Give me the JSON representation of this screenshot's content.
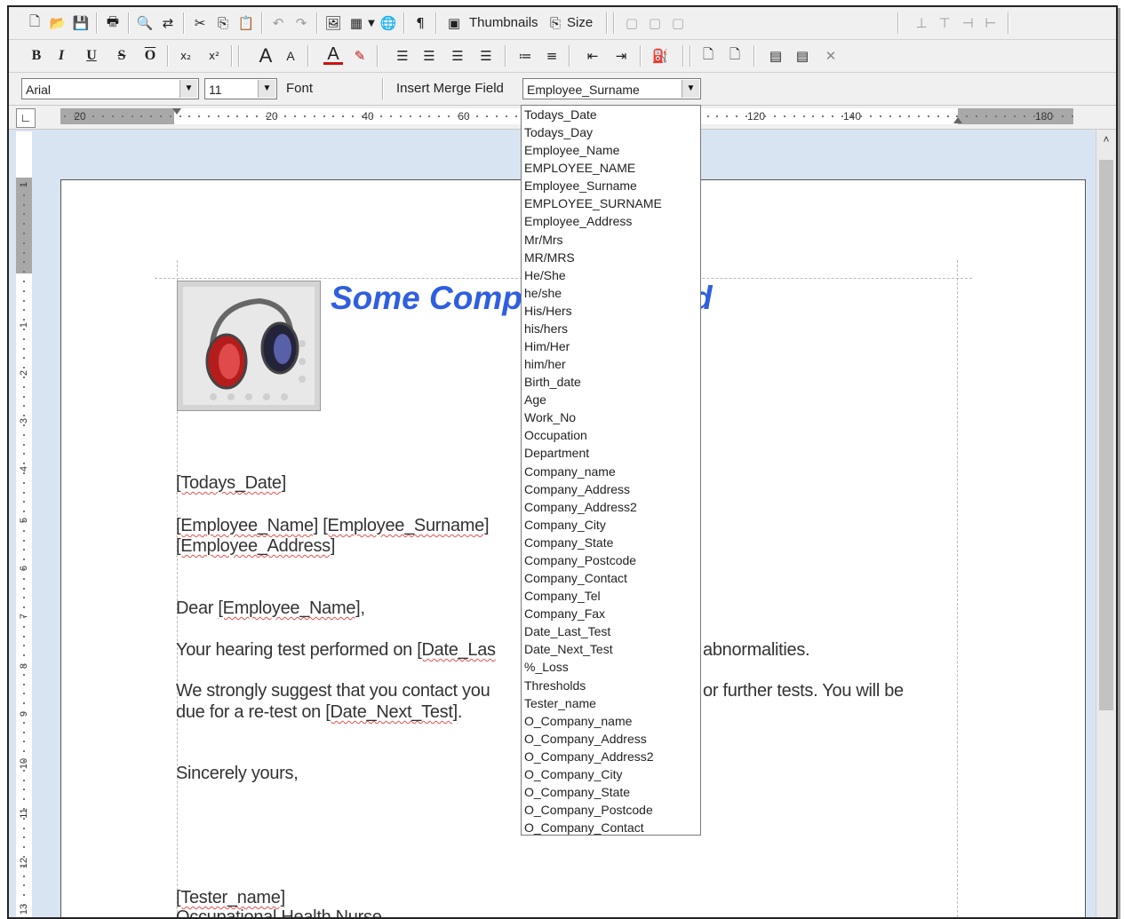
{
  "toolbar1": {
    "thumbnails_label": "Thumbnails",
    "size_label": "Size"
  },
  "toolbar2": {
    "bold_label": "B",
    "italic_label": "I",
    "underline_label": "U",
    "strike_label": "S",
    "overline_label": "O"
  },
  "toolbar3": {
    "font_name": "Arial",
    "font_size": "11",
    "font_label": "Font",
    "insert_merge_label": "Insert Merge Field",
    "merge_field_selected": "Employee_Surname"
  },
  "ruler": {
    "h_labels": [
      "20",
      "20",
      "40",
      "60",
      "120",
      "140",
      "180"
    ],
    "v_labels": [
      "1",
      "1",
      "2",
      "3",
      "4",
      "5",
      "6",
      "7",
      "8",
      "9",
      "10",
      "11",
      "12",
      "13"
    ]
  },
  "document": {
    "company_title": "Some Comp",
    "company_title_end": "d",
    "todays_date": "[Todays_Date]",
    "employee_name": "[Employee_Name]",
    "employee_surname": "[Employee_Surname]",
    "employee_address": "[Employee_Address]",
    "dear_prefix": "Dear ",
    "dear_field": "[Employee_Name]",
    "dear_suffix": ",",
    "p1_start": "Your hearing test performed on ",
    "p1_field": "[Date_Las",
    "p1_end": "abnormalities.",
    "p2_start": "We strongly suggest that you contact you",
    "p2_end": "or further tests. You will be",
    "p3_start": "due for a re-test on ",
    "p3_field": "[Date_Next_Test]",
    "p3_end": ".",
    "closing": "Sincerely yours,",
    "tester_field": "[Tester_name]",
    "tester_title": "Occupational Health Nurse"
  },
  "merge_fields": [
    "Todays_Date",
    "Todays_Day",
    "Employee_Name",
    "EMPLOYEE_NAME",
    "Employee_Surname",
    "EMPLOYEE_SURNAME",
    "Employee_Address",
    "Mr/Mrs",
    "MR/MRS",
    "He/She",
    "he/she",
    "His/Hers",
    "his/hers",
    "Him/Her",
    "him/her",
    "Birth_date",
    "Age",
    "Work_No",
    "Occupation",
    "Department",
    "Company_name",
    "Company_Address",
    "Company_Address2",
    "Company_City",
    "Company_State",
    "Company_Postcode",
    "Company_Contact",
    "Company_Tel",
    "Company_Fax",
    "Date_Last_Test",
    "Date_Next_Test",
    "%_Loss",
    "Thresholds",
    "Tester_name",
    "O_Company_name",
    "O_Company_Address",
    "O_Company_Address2",
    "O_Company_City",
    "O_Company_State",
    "O_Company_Postcode",
    "O_Company_Contact"
  ],
  "colors": {
    "title_blue": "#2f5fe0",
    "workspace": "#d9e4f2",
    "spell_underline": "#e05050"
  }
}
